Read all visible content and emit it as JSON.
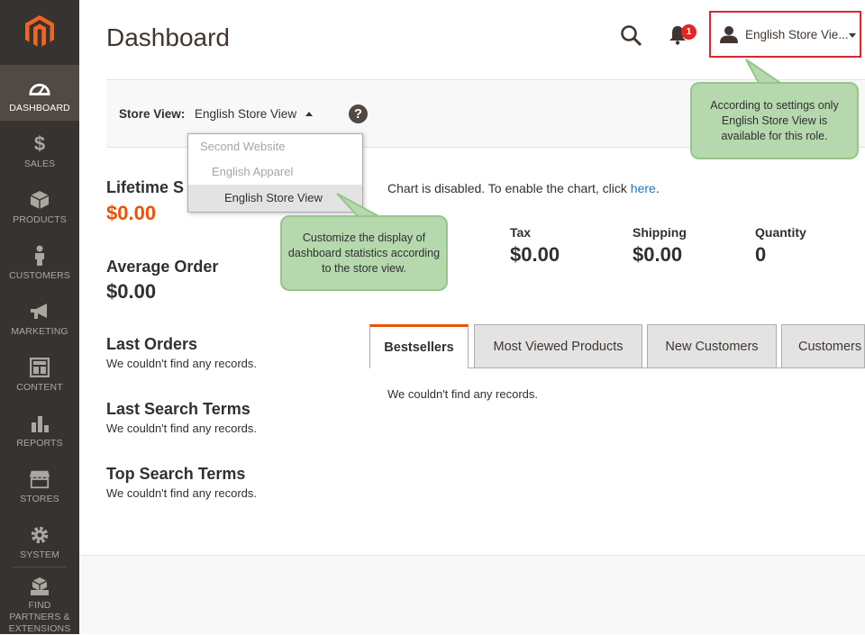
{
  "sidebar": {
    "items": [
      {
        "label": "DASHBOARD",
        "icon": "dashboard-icon"
      },
      {
        "label": "SALES",
        "icon": "dollar-icon"
      },
      {
        "label": "PRODUCTS",
        "icon": "cube-icon"
      },
      {
        "label": "CUSTOMERS",
        "icon": "person-icon"
      },
      {
        "label": "MARKETING",
        "icon": "megaphone-icon"
      },
      {
        "label": "CONTENT",
        "icon": "layout-icon"
      },
      {
        "label": "REPORTS",
        "icon": "bar-chart-icon"
      },
      {
        "label": "STORES",
        "icon": "storefront-icon"
      },
      {
        "label": "SYSTEM",
        "icon": "gear-icon"
      },
      {
        "label": "FIND PARTNERS & EXTENSIONS",
        "icon": "boxes-icon"
      }
    ]
  },
  "header": {
    "title": "Dashboard",
    "notification_count": "1",
    "account_name": "English Store Vie..."
  },
  "store_view": {
    "label": "Store View:",
    "current": "English Store View",
    "options": [
      {
        "label": "Second Website",
        "state": "disabled"
      },
      {
        "label": "English Apparel",
        "state": "disabled"
      },
      {
        "label": "English Store View",
        "state": "selected"
      }
    ]
  },
  "tooltips": {
    "account": "According to settings only English Store View is available for this role.",
    "store_view": "Customize the display of dashboard statistics according to the store view."
  },
  "stats": {
    "lifetime_sales_label": "Lifetime S",
    "lifetime_sales_value": "$0.00",
    "average_order_label": "Average Order",
    "average_order_value": "$0.00"
  },
  "sections": {
    "last_orders": {
      "title": "Last Orders",
      "text": "We couldn't find any records."
    },
    "last_search": {
      "title": "Last Search Terms",
      "text": "We couldn't find any records."
    },
    "top_search": {
      "title": "Top Search Terms",
      "text": "We couldn't find any records."
    }
  },
  "chart": {
    "message": "Chart is disabled. To enable the chart, click ",
    "link": "here",
    "message_end": "."
  },
  "totals": [
    {
      "label": "Tax",
      "value": "$0.00"
    },
    {
      "label": "Shipping",
      "value": "$0.00"
    },
    {
      "label": "Quantity",
      "value": "0"
    }
  ],
  "tabs": [
    {
      "label": "Bestsellers",
      "active": true
    },
    {
      "label": "Most Viewed Products",
      "active": false
    },
    {
      "label": "New Customers",
      "active": false
    },
    {
      "label": "Customers",
      "active": false
    }
  ],
  "tab_content": "We couldn't find any records.",
  "colors": {
    "accent": "#eb5202",
    "sidebar": "#373330",
    "tooltip": "#b5d8ad",
    "highlight_border": "#d9272e",
    "link": "#1979c3"
  }
}
